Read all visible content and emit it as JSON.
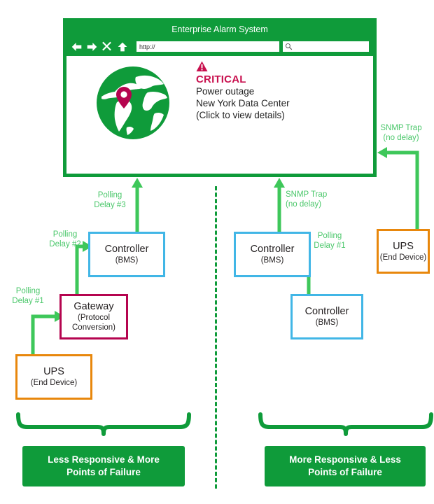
{
  "browser": {
    "title": "Enterprise Alarm System",
    "nav_icons": [
      "back-arrow-icon",
      "forward-arrow-icon",
      "close-x-icon",
      "up-arrow-icon"
    ],
    "url_value": "http://",
    "url_placeholder": "http://",
    "search_value": "",
    "search_placeholder": "",
    "search_icon": "magnifier-icon"
  },
  "alert": {
    "globe_icon": "globe-with-location-pin-icon",
    "warning_icon": "warning-triangle-icon",
    "severity": "CRITICAL",
    "line1": "Power outage",
    "line2": "New York Data Center",
    "line3": "(Click to view details)",
    "severity_color": "#c8104e",
    "globe_color": "#0f9b3a",
    "pin_color": "#b5044f"
  },
  "nodes": {
    "controller_left": {
      "title": "Controller",
      "sub": "(BMS)",
      "color": "#41b6e6"
    },
    "gateway": {
      "title": "Gateway",
      "sub": "(Protocol\nConversion)",
      "sub_line1": "(Protocol",
      "sub_line2": "Conversion)",
      "color": "#b5044f"
    },
    "ups_left": {
      "title": "UPS",
      "sub": "(End Device)",
      "color": "#e8870c"
    },
    "controller_right_top": {
      "title": "Controller",
      "sub": "(BMS)",
      "color": "#41b6e6"
    },
    "controller_right_bottom": {
      "title": "Controller",
      "sub": "(BMS)",
      "color": "#41b6e6"
    },
    "ups_right": {
      "title": "UPS",
      "sub": "(End Device)",
      "color": "#e8870c"
    }
  },
  "flows": {
    "polling_delay_3": "Polling\nDelay #3",
    "polling_delay_2": "Polling\nDelay #2",
    "polling_delay_1_left": "Polling\nDelay #1",
    "snmp_trap_right_outer": "SNMP Trap\n(no delay)",
    "snmp_trap_inner": "SNMP Trap\n(no delay)",
    "polling_delay_1_right": "Polling\nDelay #1",
    "arrow_color": "#3ec75a",
    "label_color": "#4ac76a"
  },
  "conclusions": {
    "left": "Less Responsive & More\nPoints of Failure",
    "right": "More Responsive & Less\nPoints of Failure",
    "box_color": "#0f9b3a",
    "text_color": "#ffffff"
  },
  "divider": {
    "style": "dashed-vertical",
    "color": "#0f9b3a"
  }
}
